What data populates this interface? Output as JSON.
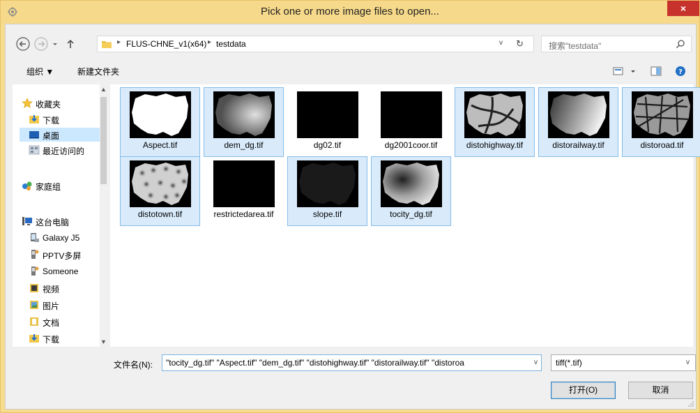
{
  "window": {
    "title": "Pick one or more image files to open...",
    "close_glyph": "×"
  },
  "address": {
    "crumbs": [
      "FLUS-CHNE_v1(x64)",
      "testdata"
    ],
    "separator_glyph": "▸",
    "dropdown_glyph": "v",
    "refresh_glyph": "↻"
  },
  "search": {
    "placeholder": "搜索\"testdata\""
  },
  "toolbar": {
    "organize": "组织 ▼",
    "new_folder": "新建文件夹"
  },
  "nav": {
    "items": [
      {
        "label": "收藏夹",
        "icon": "star-icon"
      },
      {
        "label": "下载",
        "icon": "download-folder-icon"
      },
      {
        "label": "桌面",
        "icon": "desktop-icon"
      },
      {
        "label": "最近访问的",
        "icon": "recent-places-icon"
      },
      {
        "label": "家庭组",
        "icon": "homegroup-icon"
      },
      {
        "label": "这台电脑",
        "icon": "computer-icon"
      },
      {
        "label": "Galaxy J5",
        "icon": "phone-icon"
      },
      {
        "label": "PPTV多屏",
        "icon": "media-device-icon"
      },
      {
        "label": "Someone",
        "icon": "media-device-icon"
      },
      {
        "label": "视频",
        "icon": "videos-folder-icon"
      },
      {
        "label": "图片",
        "icon": "pictures-folder-icon"
      },
      {
        "label": "文档",
        "icon": "documents-folder-icon"
      },
      {
        "label": "下载",
        "icon": "download-folder-icon"
      }
    ],
    "scroll_up_glyph": "▲",
    "scroll_down_glyph": "▼"
  },
  "files": [
    {
      "name": "Aspect.tif",
      "selected": true,
      "thumb": "mask"
    },
    {
      "name": "dem_dg.tif",
      "selected": true,
      "thumb": "dem"
    },
    {
      "name": "dg02.tif",
      "selected": false,
      "thumb": "black"
    },
    {
      "name": "dg2001coor.tif",
      "selected": false,
      "thumb": "black"
    },
    {
      "name": "distohighway.tif",
      "selected": true,
      "thumb": "highway"
    },
    {
      "name": "distorailway.tif",
      "selected": true,
      "thumb": "railway"
    },
    {
      "name": "distoroad.tif",
      "selected": true,
      "thumb": "road"
    },
    {
      "name": "distotown.tif",
      "selected": true,
      "thumb": "town"
    },
    {
      "name": "restrictedarea.tif",
      "selected": false,
      "thumb": "black"
    },
    {
      "name": "slope.tif",
      "selected": true,
      "thumb": "slope"
    },
    {
      "name": "tocity_dg.tif",
      "selected": true,
      "thumb": "city"
    }
  ],
  "bottom": {
    "filename_label": "文件名(N):",
    "filename_value": "\"tocity_dg.tif\" \"Aspect.tif\" \"dem_dg.tif\" \"distohighway.tif\" \"distorailway.tif\" \"distoroa",
    "filter_value": "tiff(*.tif)",
    "dropdown_glyph": "v",
    "open_label": "打开(O)",
    "cancel_label": "取消"
  },
  "colors": {
    "title_bar": "#f6d98a",
    "close": "#c7332c",
    "selection": "#d9ebfb",
    "selection_border": "#84bce8"
  }
}
